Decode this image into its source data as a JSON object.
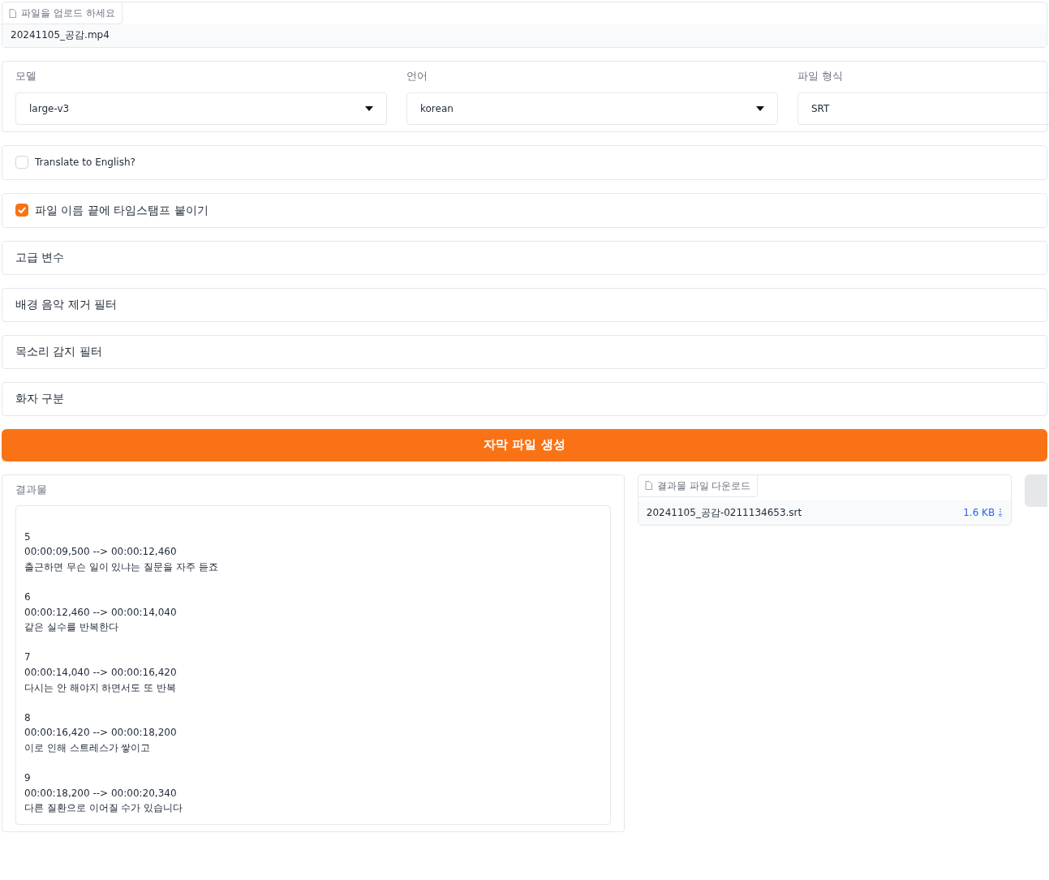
{
  "upload": {
    "label": "파일을 업로드 하세요",
    "file_name": "20241105_공감.mp4"
  },
  "dropdowns": [
    {
      "label": "모델",
      "value": "large-v3",
      "kind": "select"
    },
    {
      "label": "언어",
      "value": "korean",
      "kind": "select"
    },
    {
      "label": "파일 형식",
      "value": "SRT",
      "kind": "select"
    }
  ],
  "checkboxes": [
    {
      "label": "Translate to English?",
      "checked": false
    },
    {
      "label": "파일 이름 끝에 타임스탬프 붙이기",
      "checked": true
    }
  ],
  "accordions": [
    {
      "label": "고급 변수"
    },
    {
      "label": "배경 음악 제거 필터"
    },
    {
      "label": "목소리 감지 필터"
    },
    {
      "label": "화자 구분"
    }
  ],
  "generate_button": "자막 파일 생성",
  "output": {
    "label": "결과물",
    "entries": [
      {
        "index": "5",
        "time": "00:00:09,500 --> 00:00:12,460",
        "text": "출근하면 무슨 일이 있냐는 질문을 자주 듣죠"
      },
      {
        "index": "6",
        "time": "00:00:12,460 --> 00:00:14,040",
        "text": "같은 실수를 반복한다"
      },
      {
        "index": "7",
        "time": "00:00:14,040 --> 00:00:16,420",
        "text": "다시는 안 해야지 하면서도 또 반복"
      },
      {
        "index": "8",
        "time": "00:00:16,420 --> 00:00:18,200",
        "text": "이로 인해 스트레스가 쌓이고"
      },
      {
        "index": "9",
        "time": "00:00:18,200 --> 00:00:20,340",
        "text": "다른 질환으로 이어질 수가 있습니다"
      }
    ]
  },
  "download": {
    "label": "결과물 파일 다운로드",
    "file_name": "20241105_공감-0211134653.srt",
    "size": "1.6 KB"
  }
}
